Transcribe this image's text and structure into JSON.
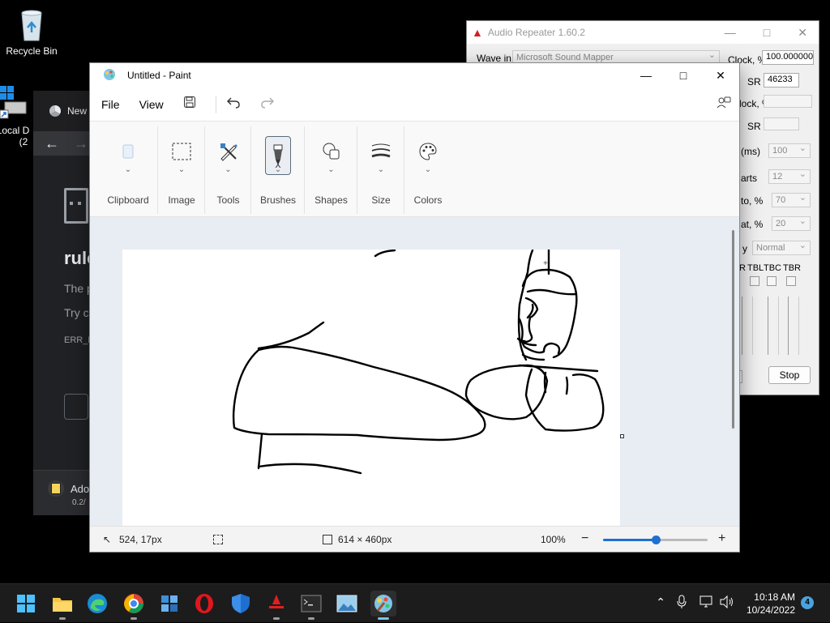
{
  "desktop": {
    "icons": [
      {
        "label": "Recycle Bin",
        "icon": "recycle-bin-icon"
      },
      {
        "label": "Local D",
        "sublabel": "(2",
        "icon": "drive-shortcut-icon"
      }
    ]
  },
  "chrome": {
    "tab_label": "New",
    "error_title": "rule",
    "line1": "The p",
    "line2": "Try c",
    "error_code": "ERR_B",
    "download_name": "Ado",
    "download_size": "0.2/"
  },
  "audio_repeater": {
    "title": "Audio Repeater 1.60.2",
    "wave_in_label": "Wave in",
    "wave_in_value": "Microsoft Sound Mapper",
    "clock_label": "Clock, %",
    "clock_value": "100.000000",
    "sr_label": "SR",
    "sr_value": "46233",
    "clock2_label": "lock, %",
    "sr2_label": "SR",
    "ms_label": "(ms)",
    "ms_value": "100",
    "parts_label": "arts",
    "parts_value": "12",
    "to_label": "to, %",
    "to_value": "70",
    "at_label": "at, %",
    "at_value": "20",
    "priority_label": "y",
    "priority_value": "Normal",
    "col_r": "R",
    "col_tbl": "TBL",
    "col_tbc": "TBC",
    "col_tbr": "TBR",
    "stop_label": "Stop"
  },
  "paint": {
    "title": "Untitled - Paint",
    "menu": {
      "file": "File",
      "view": "View"
    },
    "groups": [
      {
        "label": "Clipboard",
        "icon": "clipboard-icon"
      },
      {
        "label": "Image",
        "icon": "selection-icon"
      },
      {
        "label": "Tools",
        "icon": "tools-icon"
      },
      {
        "label": "Brushes",
        "icon": "brush-icon"
      },
      {
        "label": "Shapes",
        "icon": "shapes-icon"
      },
      {
        "label": "Size",
        "icon": "size-icon"
      },
      {
        "label": "Colors",
        "icon": "palette-icon"
      }
    ],
    "status": {
      "cursor_pos": "524, 17px",
      "canvas_size": "614 × 460px",
      "zoom": "100%",
      "zoom_level": 0.5
    }
  },
  "taskbar": {
    "time": "10:18 AM",
    "date": "10/24/2022",
    "notifications": "4"
  }
}
